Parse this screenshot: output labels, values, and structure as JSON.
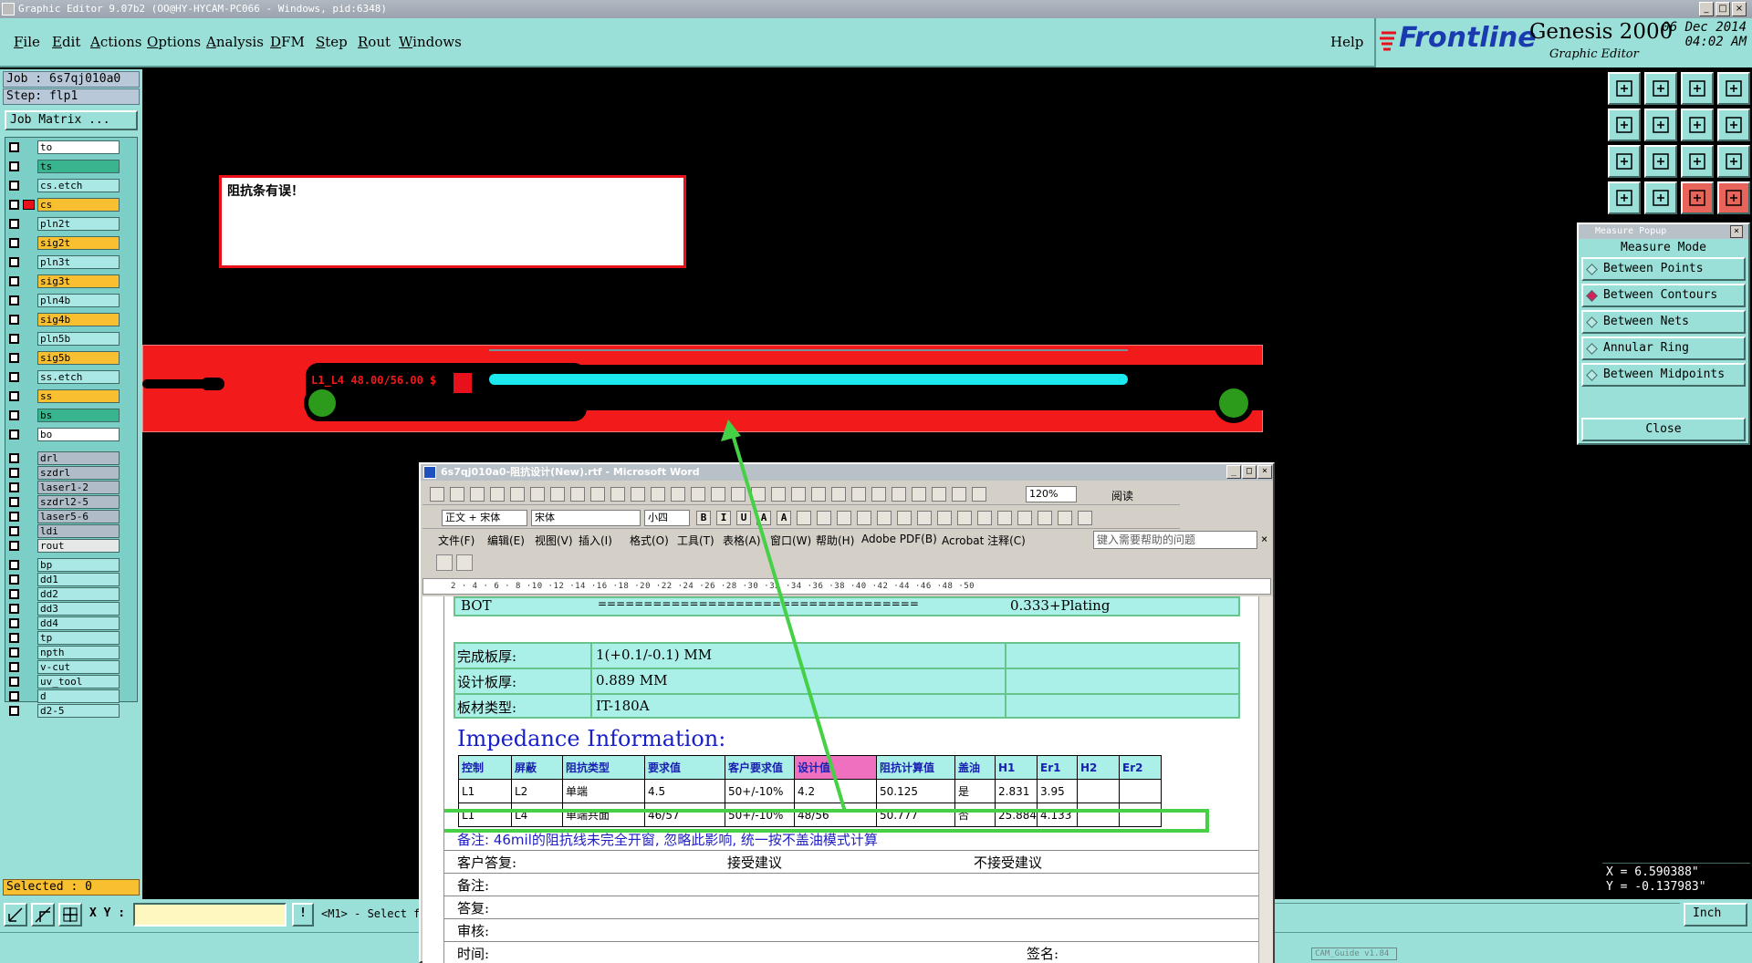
{
  "window": {
    "title": "Graphic Editor 9.07b2 (OO@HY-HYCAM-PC066 - Windows, pid:6348)"
  },
  "menu": {
    "items": [
      {
        "label": "File",
        "u": "F",
        "rest": "ile"
      },
      {
        "label": "Edit",
        "u": "E",
        "rest": "dit"
      },
      {
        "label": "Actions",
        "u": "A",
        "rest": "ctions"
      },
      {
        "label": "Options",
        "u": "O",
        "rest": "ptions"
      },
      {
        "label": "Analysis",
        "u": "A",
        "rest": "nalysis"
      },
      {
        "label": "DFM",
        "u": "D",
        "rest": "FM"
      },
      {
        "label": "Step",
        "u": "S",
        "rest": "tep"
      },
      {
        "label": "Rout",
        "u": "R",
        "rest": "out"
      },
      {
        "label": "Windows",
        "u": "W",
        "rest": "indows"
      }
    ],
    "help": "Help"
  },
  "branding": {
    "company": "Frontline",
    "product": "Genesis 2000",
    "subtitle": "Graphic Editor",
    "date": "06 Dec 2014",
    "time": "04:02 AM",
    "accent": "#1a3ab0"
  },
  "job": {
    "job_label": "Job : 6s7qj010a0",
    "step_label": "Step: flp1",
    "matrix_button": "Job Matrix ..."
  },
  "layers": [
    {
      "name": "to",
      "color": "white"
    },
    {
      "name": "ts",
      "color": "teal"
    },
    {
      "name": "cs.etch",
      "color": "cyan"
    },
    {
      "name": "cs",
      "color": "orange",
      "active": true
    },
    {
      "name": "pln2t",
      "color": "cyan"
    },
    {
      "name": "sig2t",
      "color": "orange"
    },
    {
      "name": "pln3t",
      "color": "cyan"
    },
    {
      "name": "sig3t",
      "color": "orange"
    },
    {
      "name": "pln4b",
      "color": "cyan"
    },
    {
      "name": "sig4b",
      "color": "orange"
    },
    {
      "name": "pln5b",
      "color": "cyan"
    },
    {
      "name": "sig5b",
      "color": "orange"
    },
    {
      "name": "ss.etch",
      "color": "cyan"
    },
    {
      "name": "ss",
      "color": "orange"
    },
    {
      "name": "bs",
      "color": "teal"
    },
    {
      "name": "bo",
      "color": "white"
    },
    {
      "name": "drl",
      "color": "gray"
    },
    {
      "name": "szdrl",
      "color": "gray"
    },
    {
      "name": "laser1-2",
      "color": "gray"
    },
    {
      "name": "szdrl2-5",
      "color": "gray"
    },
    {
      "name": "laser5-6",
      "color": "gray"
    },
    {
      "name": "ldi",
      "color": "gray"
    },
    {
      "name": "rout",
      "color": "light"
    },
    {
      "name": "bp",
      "color": "cyan"
    },
    {
      "name": "dd1",
      "color": "cyan"
    },
    {
      "name": "dd2",
      "color": "cyan"
    },
    {
      "name": "dd3",
      "color": "cyan"
    },
    {
      "name": "dd4",
      "color": "cyan"
    },
    {
      "name": "tp",
      "color": "cyan"
    },
    {
      "name": "npth",
      "color": "cyan"
    },
    {
      "name": "v-cut",
      "color": "cyan"
    },
    {
      "name": "uv_tool",
      "color": "cyan"
    },
    {
      "name": "d",
      "color": "cyan"
    },
    {
      "name": "d2-5",
      "color": "cyan"
    }
  ],
  "selected": "Selected : 0",
  "canvas": {
    "error_message": "阻抗条有误！",
    "trace_label": "L1_L4 48.00/56.00 $"
  },
  "measure_popup": {
    "title": "Measure Popup",
    "mode_label": "Measure Mode",
    "options": [
      {
        "label": "Between Points",
        "selected": false
      },
      {
        "label": "Between Contours",
        "selected": true
      },
      {
        "label": "Between Nets",
        "selected": false
      },
      {
        "label": "Annular Ring",
        "selected": false
      },
      {
        "label": "Between Midpoints",
        "selected": false
      }
    ],
    "close": "Close"
  },
  "coords": {
    "x": "X = 6.590388\"",
    "y": "Y = -0.137983\""
  },
  "bottom": {
    "xy_label": "X Y :",
    "status": "<M1> - Select f",
    "units": "Inch",
    "cam_guide": "CAM_Guide v1.84"
  },
  "word": {
    "title": "6s7qj010a0-阻抗设计(New).rtf - Microsoft Word",
    "style": "正文 + 宋体",
    "font": "宋体",
    "size": "小四",
    "zoom": "120%",
    "read_btn": "阅读",
    "menus": [
      "文件(F)",
      "编辑(E)",
      "视图(V)",
      "插入(I)",
      "格式(O)",
      "工具(T)",
      "表格(A)",
      "窗口(W)",
      "帮助(H)",
      "Adobe PDF(B)",
      "Acrobat 注释(C)"
    ],
    "help_placeholder": "键入需要帮助的问题",
    "ruler": "2 · 4 · 6 · 8 ·10 ·12 ·14 ·16 ·18 ·20 ·22 ·24 ·26 ·28 ·30 ·32 ·34 ·36 ·38 ·40 ·42 ·44 ·46 ·48 ·50",
    "doc": {
      "bot_label": "BOT",
      "bot_dashes": "===================================",
      "bot_value": "0.333+Plating",
      "finish_label": "完成板厚:",
      "finish_value": "1(+0.1/-0.1) MM",
      "design_label": "设计板厚:",
      "design_value": "0.889 MM",
      "material_label": "板材类型:",
      "material_value": "IT-180A",
      "heading": "Impedance Information:",
      "headers": [
        "控制",
        "屏蔽",
        "阻抗类型",
        "要求值",
        "客户要求值",
        "设计值",
        "阻抗计算值",
        "盖油",
        "H1",
        "Er1",
        "H2",
        "Er2"
      ],
      "rows": [
        [
          "L1",
          "L2",
          "单端",
          "4.5",
          "50+/-10%",
          "4.2",
          "50.125",
          "是",
          "2.831",
          "3.95",
          "",
          ""
        ],
        [
          "L1",
          "L4",
          "单端共面",
          "46/57",
          "50+/-10%",
          "48/56",
          "50.777",
          "否",
          "25.884",
          "4.133",
          "",
          ""
        ]
      ],
      "note": "备注: 46mil的阻抗线未完全开窗, 忽略此影响, 统一按不盖油模式计算",
      "reply_label": "客户答复:",
      "accept": "接受建议",
      "reject": "不接受建议",
      "remark_label": "备注:",
      "answer_label": "答复:",
      "review_label": "审核:",
      "time_label": "时间:",
      "sign_label": "签名:"
    }
  }
}
